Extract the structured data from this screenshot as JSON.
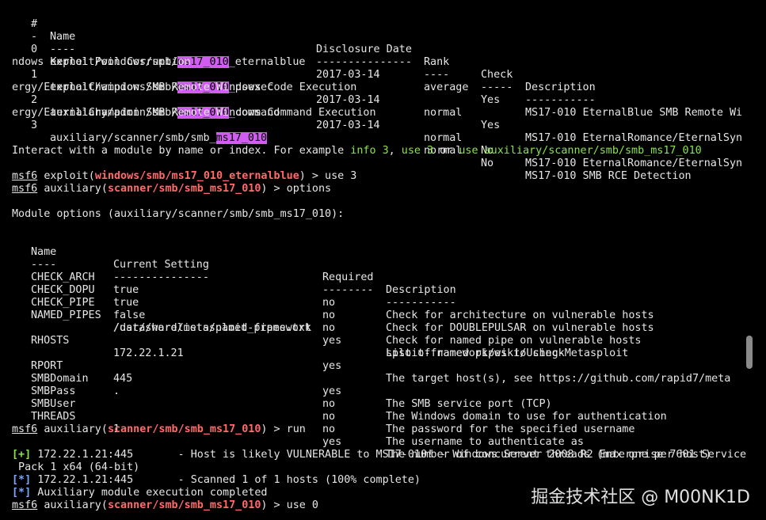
{
  "search_table": {
    "headers": [
      "#",
      "Name",
      "Disclosure Date",
      "Rank",
      "Check",
      "Description"
    ],
    "dashes": [
      "-",
      "----",
      "---------------",
      "----",
      "-----",
      "-----------"
    ],
    "rows": [
      {
        "idx": "0",
        "name_pre": "exploit/windows/smb/",
        "name_hl": "ms17_010",
        "name_post": "_eternalblue",
        "date": "2017-03-14",
        "rank": "average",
        "check": "Yes",
        "desc": "MS17-010 EternalBlue SMB Remote Wi",
        "wrap": "ndows Kernel Pool Corruption"
      },
      {
        "idx": "1",
        "name_pre": "exploit/windows/smb/",
        "name_hl": "ms17_010",
        "name_post": "_psexec",
        "date": "2017-03-14",
        "rank": "normal",
        "check": "Yes",
        "desc": "MS17-010 EternalRomance/EternalSyn",
        "wrap": "ergy/EternalChampion SMB Remote Windows Code Execution"
      },
      {
        "idx": "2",
        "name_pre": "auxiliary/admin/smb/",
        "name_hl": "ms17_010",
        "name_post": "_command",
        "date": "2017-03-14",
        "rank": "normal",
        "check": "No",
        "desc": "MS17-010 EternalRomance/EternalSyn",
        "wrap": "ergy/EternalChampion SMB Remote Windows Command Execution"
      },
      {
        "idx": "3",
        "name_pre": "auxiliary/scanner/smb/smb_",
        "name_hl": "ms17_010",
        "name_post": "",
        "date": "",
        "rank": "normal",
        "check": "No",
        "desc": "MS17-010 SMB RCE Detection",
        "wrap": ""
      }
    ]
  },
  "interact": {
    "prefix": "Interact with a module by name or index. For example ",
    "ex1": "info 3",
    "sep1": ", ",
    "ex2": "use 3",
    "sep2": " or ",
    "ex3": "use auxiliary/scanner/smb/smb_ms17_010"
  },
  "prompts": {
    "msf": "msf6",
    "p1_kind": "exploit(",
    "p1_mod": "windows/smb/ms17_010_eternalblue",
    "p1_cmd": ") > use 3",
    "p2_kind": "auxiliary(",
    "p2_mod": "scanner/smb/smb_ms17_010",
    "p2_cmd": ") > options",
    "p3_cmd": ") > run",
    "p4_cmd": ") > use 0"
  },
  "module_options": {
    "title": "Module options (auxiliary/scanner/smb/smb_ms17_010):",
    "headers": [
      "Name",
      "Current Setting",
      "Required",
      "Description"
    ],
    "dashes": [
      "----",
      "---------------",
      "--------",
      "-----------"
    ],
    "rows": [
      {
        "name": "CHECK_ARCH",
        "setting": "true",
        "req": "no",
        "desc": "Check for architecture on vulnerable hosts"
      },
      {
        "name": "CHECK_DOPU",
        "setting": "true",
        "req": "no",
        "desc": "Check for DOUBLEPULSAR on vulnerable hosts"
      },
      {
        "name": "CHECK_PIPE",
        "setting": "false",
        "req": "no",
        "desc": "Check for named pipe on vulnerable hosts"
      },
      {
        "name": "NAMED_PIPES",
        "setting": "/usr/share/metasploit-framework",
        "setting2": "/data/wordlists/named_pipes.txt",
        "req": "yes",
        "desc": "List of named pipes to check"
      },
      {
        "name": "RHOSTS",
        "setting": "172.22.1.21",
        "req": "yes",
        "desc": "The target host(s), see https://github.com/rapid7/meta",
        "desc2": "sploit-framework/wiki/Using-Metasploit"
      },
      {
        "name": "RPORT",
        "setting": "445",
        "req": "yes",
        "desc": "The SMB service port (TCP)"
      },
      {
        "name": "SMBDomain",
        "setting": ".",
        "req": "no",
        "desc": "The Windows domain to use for authentication"
      },
      {
        "name": "SMBPass",
        "setting": "",
        "req": "no",
        "desc": "The password for the specified username"
      },
      {
        "name": "SMBUser",
        "setting": "",
        "req": "no",
        "desc": "The username to authenticate as"
      },
      {
        "name": "THREADS",
        "setting": "1",
        "req": "yes",
        "desc": "The number of concurrent threads (max one per host)"
      }
    ]
  },
  "run_output": [
    {
      "tag": "[+]",
      "tag_color": "green",
      "text": " 172.22.1.21:445       - Host is likely VULNERABLE to MS17-010! - Windows Server 2008 R2 Enterprise 7601 Service",
      "wrap": " Pack 1 x64 (64-bit)"
    },
    {
      "tag": "[*]",
      "tag_color": "blue",
      "text": " 172.22.1.21:445       - Scanned 1 of 1 hosts (100% complete)",
      "wrap": ""
    },
    {
      "tag": "[*]",
      "tag_color": "blue",
      "text": " Auxiliary module execution completed",
      "wrap": ""
    }
  ],
  "watermark": "掘金技术社区 @ M00NK1D",
  "colors": {
    "background": "#000000",
    "text": "#e6e6e6",
    "highlight": "#d15cf0",
    "green": "#8be34f",
    "red": "#ff6b6b",
    "blue": "#7aa7ff"
  }
}
